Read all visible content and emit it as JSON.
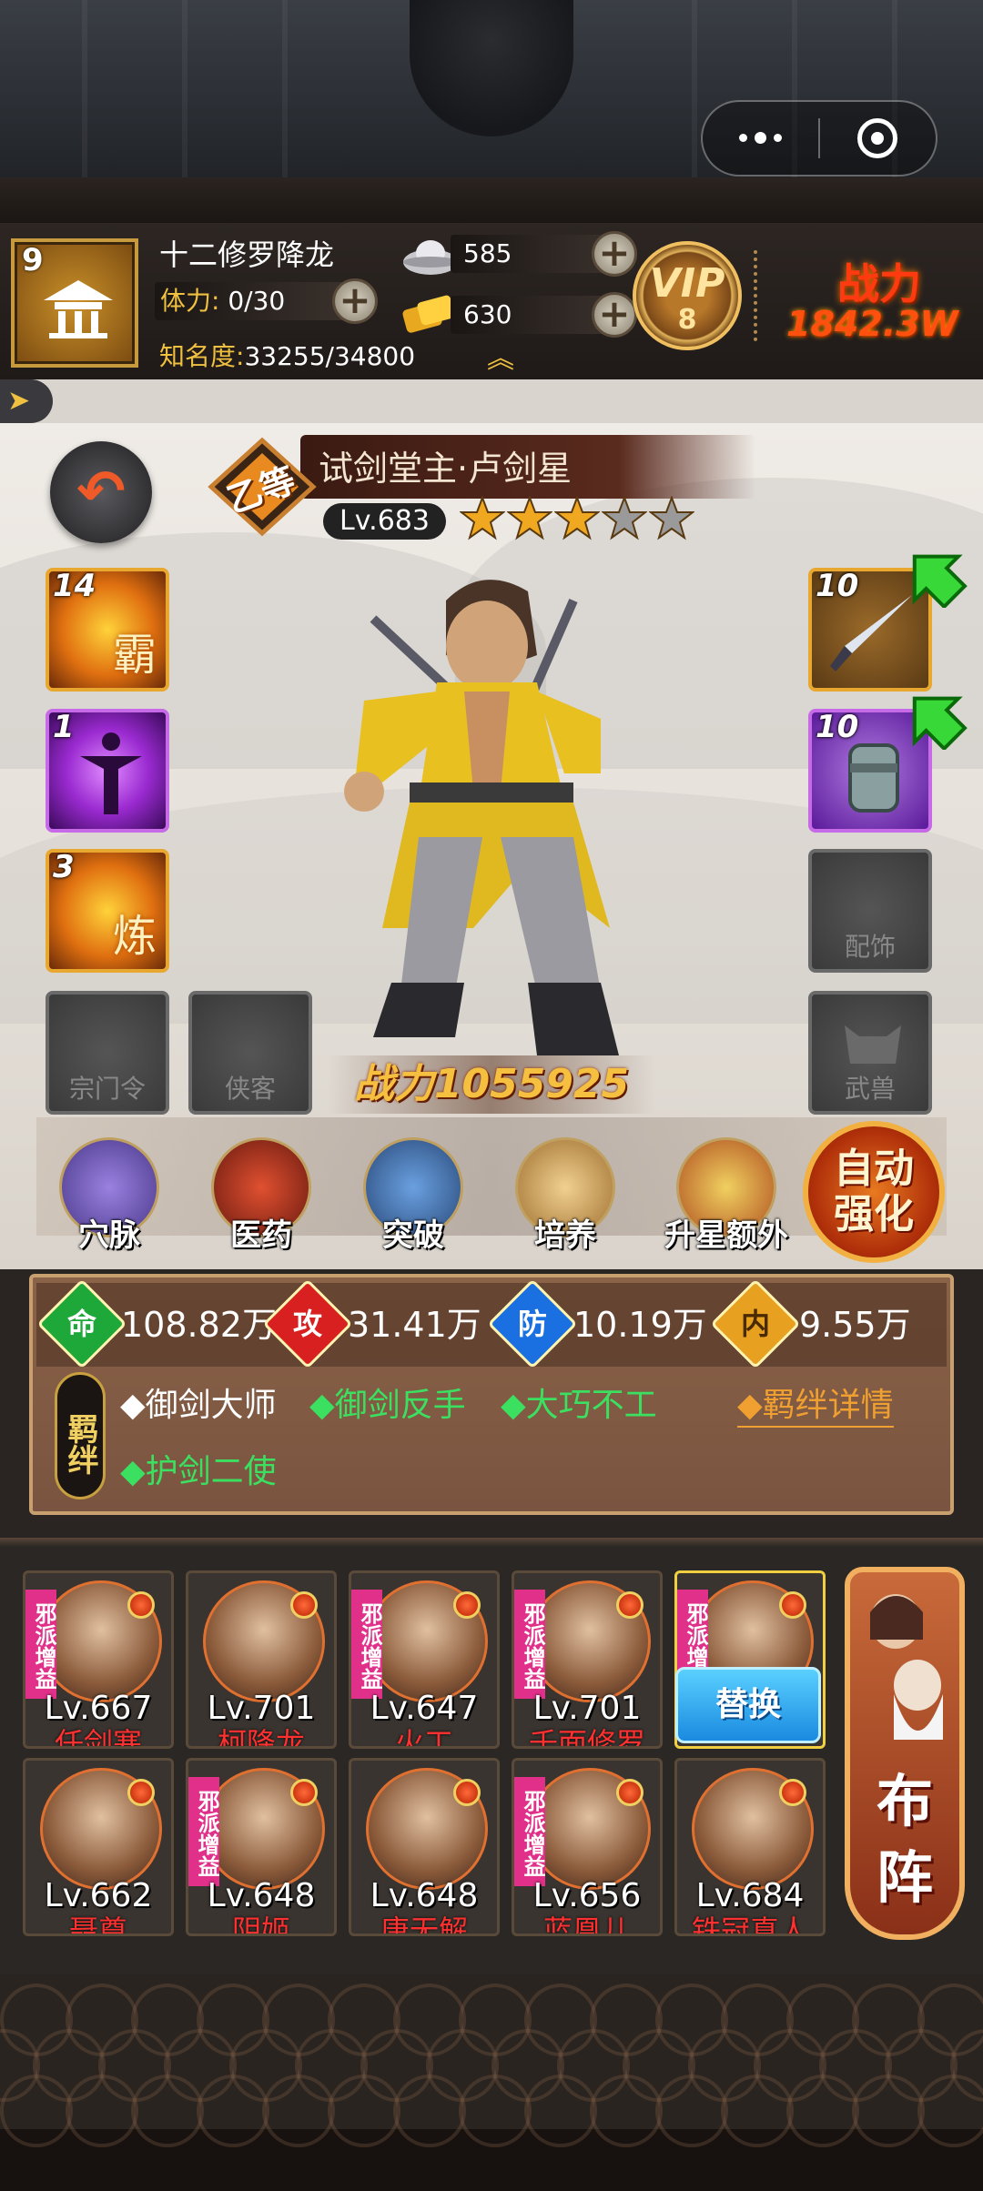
{
  "player": {
    "level": "9",
    "name": "十二修罗降龙",
    "stamina_label": "体力:",
    "stamina": "0/30",
    "fame_label": "知名度:",
    "fame": "33255/34800",
    "silver": "585",
    "gold": "630",
    "vip_label": "VIP",
    "vip_level": "8",
    "power_label": "战力",
    "power_value": "1842.3W"
  },
  "hero": {
    "grade": "乙等",
    "name": "试剑堂主·卢剑星",
    "level": "Lv.683",
    "stars_filled": 3,
    "stars_total": 5,
    "combat_power": "战力1055925"
  },
  "skills": [
    {
      "num": "14",
      "glyph": "霸"
    },
    {
      "num": "1",
      "glyph": ""
    },
    {
      "num": "3",
      "glyph": "炼"
    }
  ],
  "empty_slots": {
    "sect_token": "宗门令",
    "companion": "侠客",
    "accessory": "配饰",
    "beast": "武兽"
  },
  "equip": [
    {
      "num": "10"
    },
    {
      "num": "10"
    }
  ],
  "functions": [
    {
      "label": "穴脉"
    },
    {
      "label": "医药"
    },
    {
      "label": "突破"
    },
    {
      "label": "培养"
    },
    {
      "label": "升星额外"
    }
  ],
  "auto_strengthen": [
    "自动",
    "强化"
  ],
  "stats": {
    "hp_icon": "命",
    "hp": "108.82万",
    "atk_icon": "攻",
    "atk": "31.41万",
    "def_icon": "防",
    "def": "10.19万",
    "inner_icon": "内",
    "inner": "9.55万"
  },
  "fetters": {
    "badge": "羁绊",
    "items": [
      "◆御剑大师",
      "◆御剑反手",
      "◆大巧不工",
      "◆护剑二使"
    ],
    "detail": "◆羁绊详情"
  },
  "roster": [
    {
      "level": "Lv.667",
      "name": "任剑寒",
      "evil": true
    },
    {
      "level": "Lv.701",
      "name": "柯降龙",
      "evil": false
    },
    {
      "level": "Lv.647",
      "name": "火工",
      "evil": true
    },
    {
      "level": "Lv.701",
      "name": "千面修罗",
      "evil": true
    },
    {
      "level": "",
      "name": "",
      "evil": true
    },
    {
      "level": "Lv.662",
      "name": "聂尊",
      "evil": false
    },
    {
      "level": "Lv.648",
      "name": "阴姬",
      "evil": true
    },
    {
      "level": "Lv.648",
      "name": "唐无解",
      "evil": false
    },
    {
      "level": "Lv.656",
      "name": "蓝凰儿",
      "evil": true
    },
    {
      "level": "Lv.684",
      "name": "铁冠真人",
      "evil": false
    }
  ],
  "evil_tag": "邪派增益",
  "swap_label": "替换",
  "formation_label": [
    "布",
    "阵"
  ],
  "colors": {
    "gold": "#f0c040",
    "fetter_active": "#3ce060",
    "red_name": "#ff3030"
  }
}
